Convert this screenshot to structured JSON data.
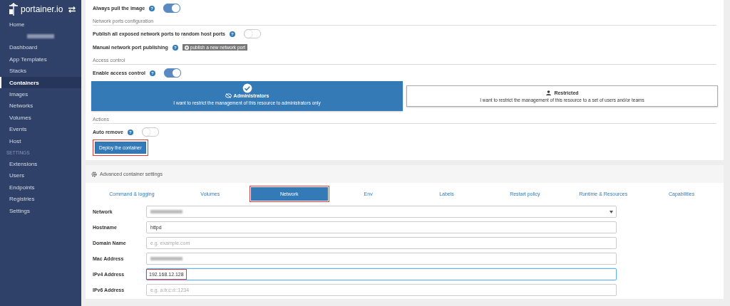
{
  "sidebar": {
    "logo": "portainer.io",
    "home": {
      "label": "Home",
      "selected": false
    },
    "endpoint_name_blurred": true,
    "items": [
      {
        "label": "Dashboard",
        "selected": false
      },
      {
        "label": "App Templates",
        "selected": false
      },
      {
        "label": "Stacks",
        "selected": false
      },
      {
        "label": "Containers",
        "selected": true
      },
      {
        "label": "Images",
        "selected": false
      },
      {
        "label": "Networks",
        "selected": false
      },
      {
        "label": "Volumes",
        "selected": false
      },
      {
        "label": "Events",
        "selected": false
      },
      {
        "label": "Host",
        "selected": false
      }
    ],
    "settings_header": "SETTINGS",
    "settings_items": [
      {
        "label": "Extensions",
        "selected": false
      },
      {
        "label": "Users",
        "selected": false
      },
      {
        "label": "Endpoints",
        "selected": false
      },
      {
        "label": "Registries",
        "selected": false
      },
      {
        "label": "Settings",
        "selected": false
      }
    ]
  },
  "top_rows": [
    {
      "kind": "toggle",
      "label": "Always pull the image",
      "help": "?",
      "on": true
    },
    {
      "kind": "heading",
      "label": "Network ports configuration"
    },
    {
      "kind": "toggle",
      "label": "Publish all exposed network ports to random host ports",
      "help": "?",
      "on": false
    },
    {
      "kind": "publish",
      "label": "Manual network port publishing",
      "help": "?",
      "button": "publish a new network port"
    },
    {
      "kind": "heading",
      "label": "Access control"
    },
    {
      "kind": "toggle",
      "label": "Enable access control",
      "help": "?",
      "on": true
    },
    {
      "kind": "cards",
      "cards": [
        {
          "title": "Administrators",
          "description": "I want to restrict the management of this resource to administrators only",
          "selected": true
        },
        {
          "title": "Restricted",
          "description": "I want to restrict the management of this resource to a set of users and/or teams",
          "selected": false
        }
      ]
    },
    {
      "kind": "heading",
      "label": "Actions"
    },
    {
      "kind": "toggle",
      "label": "Auto remove",
      "help": "?",
      "on": false
    },
    {
      "kind": "deploy",
      "button": "Deploy the container",
      "highlighted": true
    }
  ],
  "advanced": {
    "title": "Advanced container settings",
    "tabs": [
      {
        "label": "Command & logging",
        "selected": false,
        "highlighted": false
      },
      {
        "label": "Volumes",
        "selected": false,
        "highlighted": false
      },
      {
        "label": "Network",
        "selected": true,
        "highlighted": true
      },
      {
        "label": "Env",
        "selected": false,
        "highlighted": false
      },
      {
        "label": "Labels",
        "selected": false,
        "highlighted": false
      },
      {
        "label": "Restart policy",
        "selected": false,
        "highlighted": false
      },
      {
        "label": "Runtime & Resources",
        "selected": false,
        "highlighted": false
      },
      {
        "label": "Capabilities",
        "selected": false,
        "highlighted": false
      }
    ],
    "fields": [
      {
        "kind": "select",
        "label": "Network",
        "blurred": true
      },
      {
        "kind": "input",
        "label": "Hostname",
        "value": "httpd"
      },
      {
        "kind": "input",
        "label": "Domain Name",
        "placeholder": "e.g. example.com"
      },
      {
        "kind": "input",
        "label": "Mac Address",
        "blurred": true
      },
      {
        "kind": "input",
        "label": "IPv4 Address",
        "value": "192.168.12.128",
        "focused": true,
        "highlighted": true
      },
      {
        "kind": "input",
        "label": "IPv6 Address",
        "placeholder": "e.g. a:b:c:d::1234"
      }
    ]
  }
}
